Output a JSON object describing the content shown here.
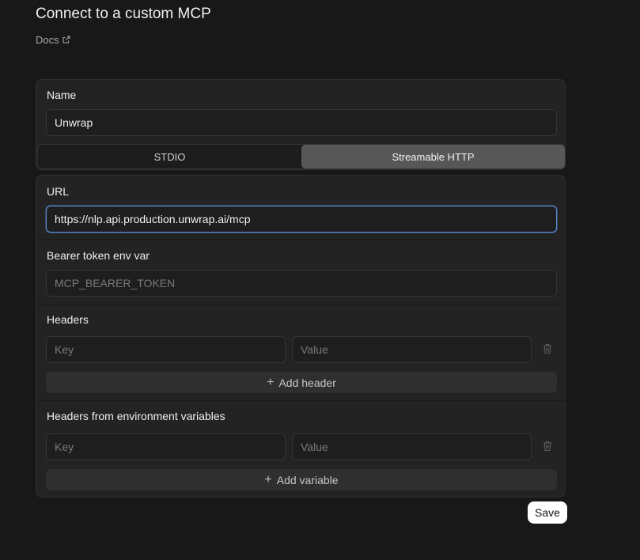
{
  "page": {
    "title": "Connect to a custom MCP",
    "docs_label": "Docs"
  },
  "name_section": {
    "label": "Name",
    "value": "Unwrap"
  },
  "transport": {
    "options": [
      "STDIO",
      "Streamable HTTP"
    ],
    "selected": "Streamable HTTP"
  },
  "url_section": {
    "label": "URL",
    "value": "https://nlp.api.production.unwrap.ai/mcp"
  },
  "bearer_section": {
    "label": "Bearer token env var",
    "placeholder": "MCP_BEARER_TOKEN",
    "value": ""
  },
  "headers_section": {
    "label": "Headers",
    "key_placeholder": "Key",
    "value_placeholder": "Value",
    "add_label": "Add header"
  },
  "env_headers_section": {
    "label": "Headers from environment variables",
    "key_placeholder": "Key",
    "value_placeholder": "Value",
    "add_label": "Add variable"
  },
  "actions": {
    "save_label": "Save"
  },
  "icons": {
    "docs": "external-link-icon",
    "delete": "trash-icon",
    "add": "plus-icon"
  },
  "colors": {
    "background": "#181818",
    "card": "#232323",
    "segment_active": "#575757",
    "focus_border": "#5b8ed6",
    "save_button": "#ffffff"
  }
}
